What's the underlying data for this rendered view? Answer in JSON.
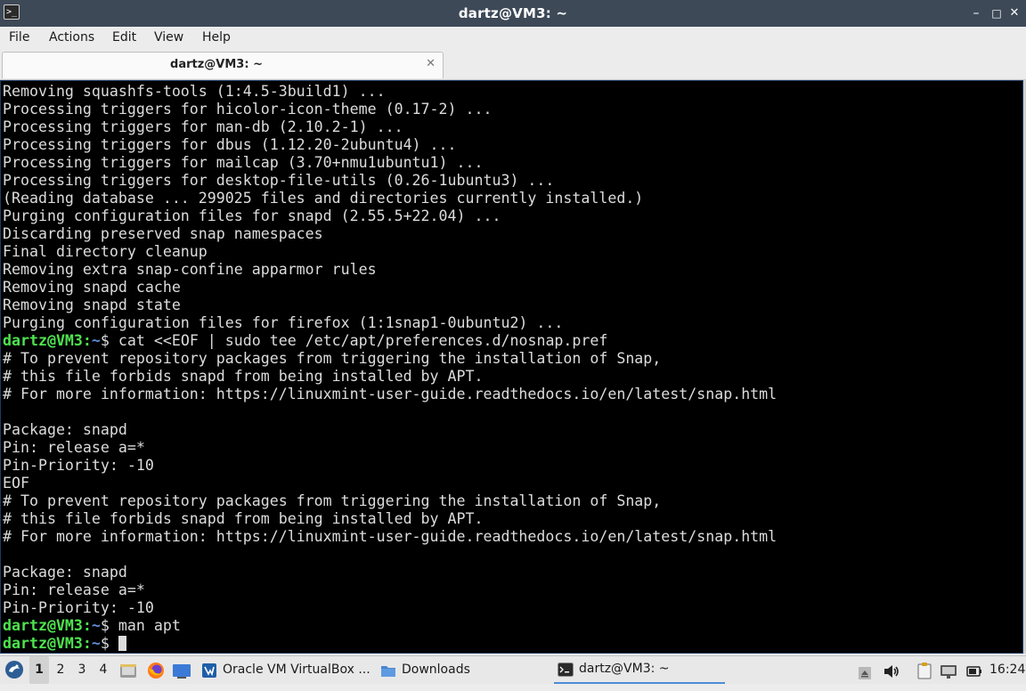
{
  "window": {
    "title": "dartz@VM3: ~",
    "icon": "terminal-icon",
    "controls": {
      "minimize": "–",
      "maximize": "□",
      "close": "✕"
    }
  },
  "menubar": {
    "items": [
      "File",
      "Actions",
      "Edit",
      "View",
      "Help"
    ]
  },
  "tab": {
    "label": "dartz@VM3: ~",
    "close": "✕"
  },
  "terminal": {
    "prompt_user": "dartz@VM3",
    "prompt_path": "~",
    "prompt_suffix": "$ ",
    "lines": [
      "Removing squashfs-tools (1:4.5-3build1) ...",
      "Processing triggers for hicolor-icon-theme (0.17-2) ...",
      "Processing triggers for man-db (2.10.2-1) ...",
      "Processing triggers for dbus (1.12.20-2ubuntu4) ...",
      "Processing triggers for mailcap (3.70+nmu1ubuntu1) ...",
      "Processing triggers for desktop-file-utils (0.26-1ubuntu3) ...",
      "(Reading database ... 299025 files and directories currently installed.)",
      "Purging configuration files for snapd (2.55.5+22.04) ...",
      "Discarding preserved snap namespaces",
      "Final directory cleanup",
      "Removing extra snap-confine apparmor rules",
      "Removing snapd cache",
      "Removing snapd state",
      "Purging configuration files for firefox (1:1snap1-0ubuntu2) ...",
      "cat <<EOF | sudo tee /etc/apt/preferences.d/nosnap.pref",
      "# To prevent repository packages from triggering the installation of Snap,",
      "# this file forbids snapd from being installed by APT.",
      "# For more information: https://linuxmint-user-guide.readthedocs.io/en/latest/snap.html",
      "",
      "Package: snapd",
      "Pin: release a=*",
      "Pin-Priority: -10",
      "EOF",
      "# To prevent repository packages from triggering the installation of Snap,",
      "# this file forbids snapd from being installed by APT.",
      "# For more information: https://linuxmint-user-guide.readthedocs.io/en/latest/snap.html",
      "",
      "Package: snapd",
      "Pin: release a=*",
      "Pin-Priority: -10",
      "man apt",
      ""
    ]
  },
  "taskbar": {
    "start_icon": "start-menu-icon",
    "workspaces": [
      "1",
      "2",
      "3",
      "4"
    ],
    "launchers": [
      "file-manager-icon",
      "firefox-icon",
      "show-desktop-icon"
    ],
    "tasks": [
      {
        "label": "Oracle VM VirtualBox ...",
        "icon": "virtualbox-icon"
      },
      {
        "label": "Downloads",
        "icon": "folder-icon"
      },
      {
        "label": "dartz@VM3: ~",
        "icon": "terminal-icon"
      }
    ],
    "tray": [
      "eject-icon",
      "volume-icon",
      "clipboard-icon",
      "network-icon",
      "power-icon"
    ],
    "clock": "16:24"
  },
  "colors": {
    "titlebar": "#3d4957",
    "terminal_bg": "#000000",
    "terminal_fg": "#dcdcdc",
    "prompt_user": "#4ee44e",
    "prompt_path": "#5c8dd6"
  }
}
